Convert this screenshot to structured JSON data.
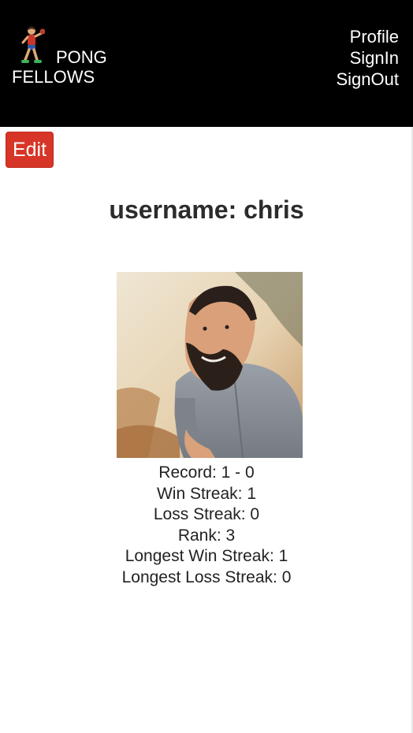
{
  "header": {
    "brand_line1": "PONG",
    "brand_line2": "FELLOWS",
    "logo_icon": "ping-pong-player-icon",
    "nav": [
      "Profile",
      "SignIn",
      "SignOut"
    ],
    "background": "#000000"
  },
  "edit_button": {
    "label": "Edit",
    "color": "#d63527"
  },
  "profile": {
    "title": "username: chris",
    "avatar": "profile-photo",
    "stats": [
      "Record: 1 - 0",
      "Win Streak: 1",
      "Loss Streak: 0",
      "Rank: 3",
      "Longest Win Streak: 1",
      "Longest Loss Streak: 0"
    ]
  }
}
